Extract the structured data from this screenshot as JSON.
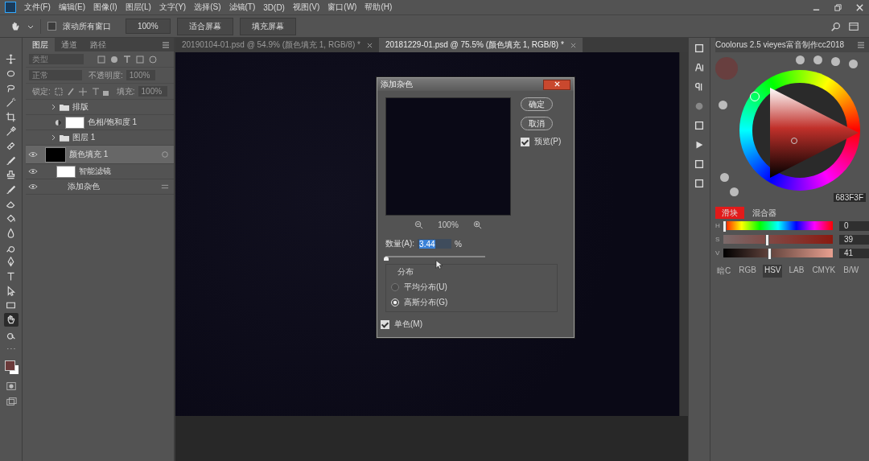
{
  "menu_bar": {
    "items": [
      "文件(F)",
      "编辑(E)",
      "图像(I)",
      "图层(L)",
      "文字(Y)",
      "选择(S)",
      "滤镜(T)",
      "3D(D)",
      "视图(V)",
      "窗口(W)",
      "帮助(H)"
    ]
  },
  "options_bar": {
    "scroll_all": {
      "label": "滚动所有窗口",
      "checked": false
    },
    "buttons": [
      "100%",
      "适合屏幕",
      "填充屏幕"
    ]
  },
  "tools": [
    {
      "kind": "move",
      "selected": false
    },
    {
      "kind": "marquee",
      "selected": false
    },
    {
      "kind": "lasso",
      "selected": false
    },
    {
      "kind": "wand",
      "selected": false
    },
    {
      "kind": "crop",
      "selected": false
    },
    {
      "kind": "eyedropper",
      "selected": false
    },
    {
      "kind": "bandage",
      "selected": false
    },
    {
      "kind": "brush",
      "selected": false
    },
    {
      "kind": "stamp",
      "selected": false
    },
    {
      "kind": "brush",
      "selected": false
    },
    {
      "kind": "eraser",
      "selected": false
    },
    {
      "kind": "bucket",
      "selected": false
    },
    {
      "kind": "drop",
      "selected": false
    },
    {
      "kind": "dodge",
      "selected": false
    },
    {
      "kind": "pen",
      "selected": false
    },
    {
      "kind": "type",
      "selected": false
    },
    {
      "kind": "arrow",
      "selected": false
    },
    {
      "kind": "rect",
      "selected": false
    },
    {
      "kind": "hand",
      "selected": true
    },
    {
      "kind": "zoom",
      "selected": false
    },
    {
      "kind": "more",
      "selected": false
    }
  ],
  "document_tabs": [
    {
      "label": "20190104-01.psd @ 54.9% (颜色填充 1, RGB/8) *",
      "selected": false
    },
    {
      "label": "20181229-01.psd @ 75.5% (颜色填充 1, RGB/8) *",
      "selected": true
    }
  ],
  "layers_panel": {
    "tabs": [
      {
        "label": "图层",
        "selected": true
      },
      {
        "label": "通道",
        "selected": false
      },
      {
        "label": "路径",
        "selected": false
      }
    ],
    "filter_placeholder": "类型",
    "blend_mode": "正常",
    "opacity_label": "不透明度:",
    "opacity": "100%",
    "lock_label": "锁定:",
    "fill_label": "填充:",
    "fill": "100%",
    "layers": [
      {
        "kind": "group",
        "name": "排版",
        "visible": false,
        "selected": false
      },
      {
        "kind": "adjustment",
        "name": "色相/饱和度 1",
        "visible": false,
        "selected": false
      },
      {
        "kind": "group",
        "name": "图层 1",
        "visible": false,
        "selected": false
      },
      {
        "kind": "fill",
        "name": "颜色填充 1",
        "visible": true,
        "selected": true,
        "children": [
          {
            "kind": "smart-filters",
            "name": "智能滤镜",
            "visible": true,
            "selected": false,
            "children": [
              {
                "kind": "filter",
                "name": "添加杂色",
                "visible": true,
                "selected": false
              }
            ]
          }
        ]
      }
    ]
  },
  "dialog": {
    "title": "添加杂色",
    "ok": "确定",
    "cancel": "取消",
    "preview": {
      "label": "预览(P)",
      "checked": true
    },
    "zoom": "100%",
    "amount_label": "数量(A):",
    "amount": "3.44",
    "unit": "%",
    "amount_slider": {
      "level": 0.01
    },
    "distribution": {
      "title": "分布",
      "options": [
        {
          "label": "平均分布(U)",
          "selected": false
        },
        {
          "label": "高斯分布(G)",
          "selected": true
        }
      ]
    },
    "monochrome": {
      "label": "单色(M)",
      "checked": true
    }
  },
  "color_panel": {
    "title": "Coolorus 2.5 vieyes富音制作cc2018",
    "hex": "683F3F",
    "tabs": [
      {
        "label": "滑块",
        "selected": true
      },
      {
        "label": "混合器",
        "selected": false
      }
    ],
    "sliders": [
      {
        "label": "H",
        "kind": "hue",
        "level": 0,
        "value": "0"
      },
      {
        "label": "S",
        "kind": "saturation",
        "level": 0.39,
        "value": "39"
      },
      {
        "label": "V",
        "kind": "value",
        "level": 0.41,
        "value": "41"
      }
    ],
    "modes": [
      {
        "label": "暗C",
        "selected": false
      },
      {
        "label": "RGB",
        "selected": false
      },
      {
        "label": "HSV",
        "selected": true
      },
      {
        "label": "LAB",
        "selected": false
      },
      {
        "label": "CMYK",
        "selected": false
      },
      {
        "label": "B/W",
        "selected": false
      }
    ]
  }
}
